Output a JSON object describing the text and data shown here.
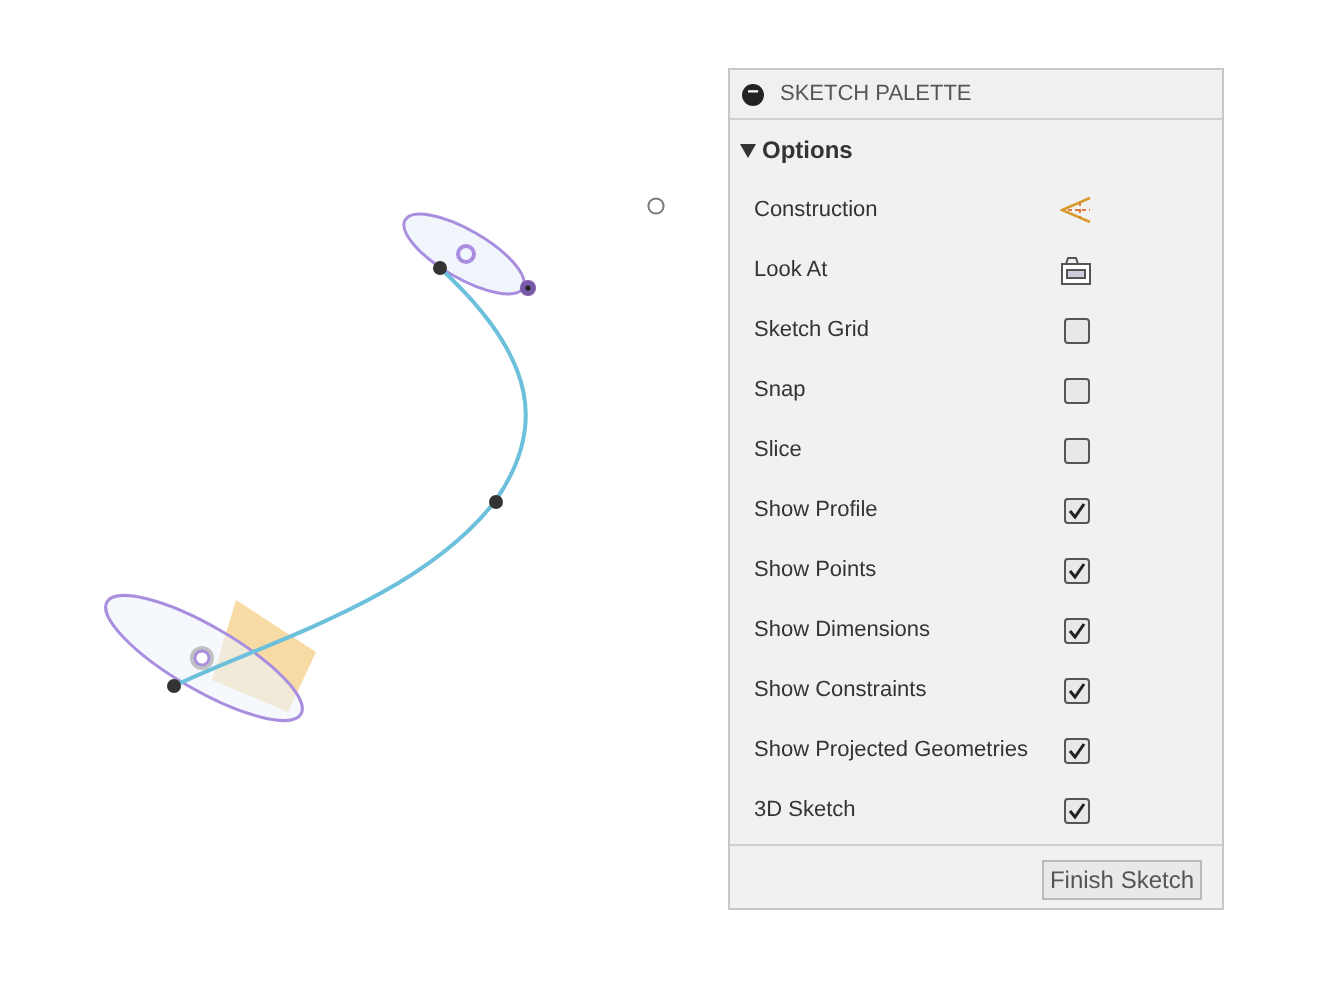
{
  "palette": {
    "title": "SKETCH PALETTE",
    "collapse_icon": "−",
    "section": {
      "label": "Options",
      "expanded": true
    },
    "options": [
      {
        "kind": "construction",
        "label": "Construction"
      },
      {
        "kind": "lookat",
        "label": "Look At"
      },
      {
        "kind": "checkbox",
        "label": "Sketch Grid",
        "checked": false
      },
      {
        "kind": "checkbox",
        "label": "Snap",
        "checked": false
      },
      {
        "kind": "checkbox",
        "label": "Slice",
        "checked": false
      },
      {
        "kind": "checkbox",
        "label": "Show Profile",
        "checked": true
      },
      {
        "kind": "checkbox",
        "label": "Show Points",
        "checked": true
      },
      {
        "kind": "checkbox",
        "label": "Show Dimensions",
        "checked": true
      },
      {
        "kind": "checkbox",
        "label": "Show Constraints",
        "checked": true
      },
      {
        "kind": "checkbox",
        "label": "Show Projected Geometries",
        "checked": true
      },
      {
        "kind": "checkbox",
        "label": "3D Sketch",
        "checked": true
      }
    ],
    "finish_button": "Finish Sketch"
  }
}
